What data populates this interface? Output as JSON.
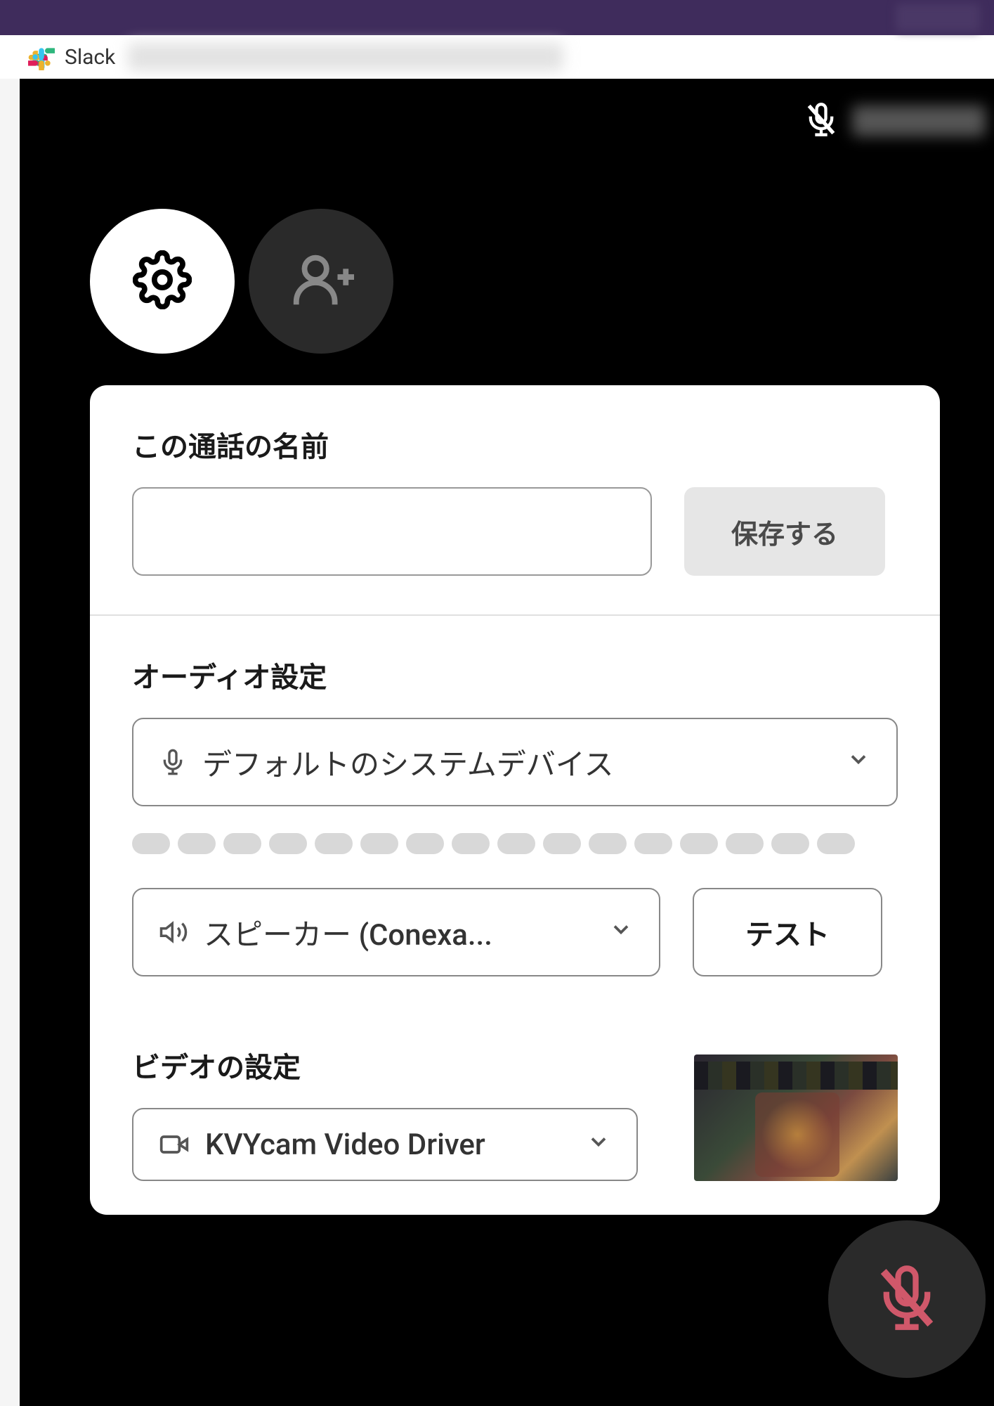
{
  "browser_tab": {
    "app_name": "Slack"
  },
  "settings_panel": {
    "call_name": {
      "title": "この通話の名前",
      "value": "",
      "save_label": "保存する"
    },
    "audio": {
      "title": "オーディオ設定",
      "microphone_selected": "デフォルトのシステムデバイス",
      "speaker_selected": "スピーカー (Conexa...",
      "test_label": "テスト"
    },
    "video": {
      "title": "ビデオの設定",
      "camera_selected": "KVYcam Video Driver"
    }
  }
}
